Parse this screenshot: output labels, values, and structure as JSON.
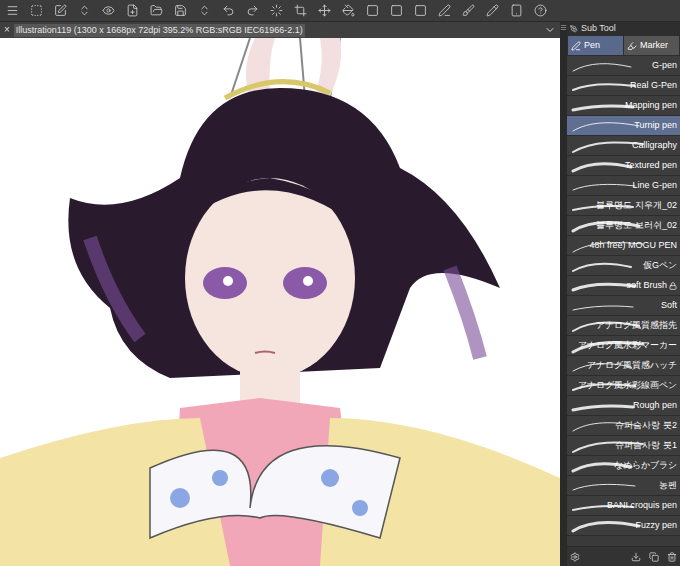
{
  "window": {
    "close": "×",
    "title": "Illustration119 (1300 x 1668px 72dpi 395.2%  RGB:sRGB IEC61966-2.1)"
  },
  "panel": {
    "title": "Sub Tool"
  },
  "tabs": [
    {
      "label": "Pen",
      "selected": true
    },
    {
      "label": "Marker",
      "selected": false
    }
  ],
  "brushes": [
    {
      "name": "G-pen",
      "selected": false,
      "locked": false
    },
    {
      "name": "Real G-Pen",
      "selected": false,
      "locked": false
    },
    {
      "name": "Mapping pen",
      "selected": false,
      "locked": false
    },
    {
      "name": "Turnip pen",
      "selected": true,
      "locked": false
    },
    {
      "name": "Calligraphy",
      "selected": false,
      "locked": false
    },
    {
      "name": "Textured pen",
      "selected": false,
      "locked": false
    },
    {
      "name": "Line G-pen",
      "selected": false,
      "locked": false
    },
    {
      "name": "블루명도 지우개_02",
      "selected": false,
      "locked": false
    },
    {
      "name": "블루명도 브러쉬_02",
      "selected": false,
      "locked": false
    },
    {
      "name": "48h free) MOGU PEN",
      "selected": false,
      "locked": false
    },
    {
      "name": "仮Gペン",
      "selected": false,
      "locked": false
    },
    {
      "name": "soft Brush",
      "selected": false,
      "locked": true
    },
    {
      "name": "Soft",
      "selected": false,
      "locked": false
    },
    {
      "name": "アナログ風質感指先",
      "selected": false,
      "locked": false
    },
    {
      "name": "アナログ風水彩マーカー",
      "selected": false,
      "locked": false
    },
    {
      "name": "アナログ風質感ハッチ",
      "selected": false,
      "locked": false
    },
    {
      "name": "アナログ風水彩線画ペン",
      "selected": false,
      "locked": false
    },
    {
      "name": "Rough pen",
      "selected": false,
      "locked": false
    },
    {
      "name": "슈퍼슴사랑 붓2",
      "selected": false,
      "locked": false
    },
    {
      "name": "슈퍼슴사랑 붓1",
      "selected": false,
      "locked": false
    },
    {
      "name": "なめらかブラシ",
      "selected": false,
      "locked": false
    },
    {
      "name": "농펜",
      "selected": false,
      "locked": false
    },
    {
      "name": "BANI croquis pen",
      "selected": false,
      "locked": false
    },
    {
      "name": "Fuzzy pen",
      "selected": false,
      "locked": false
    }
  ]
}
